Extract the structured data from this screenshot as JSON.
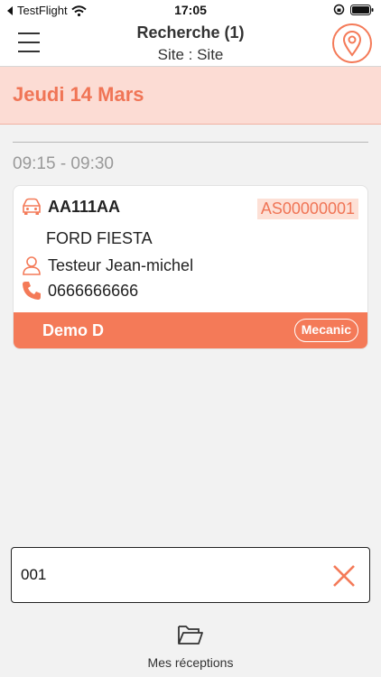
{
  "status_bar": {
    "back_app": "TestFlight",
    "time": "17:05",
    "icons": [
      "wifi-icon",
      "orientation-lock-icon",
      "battery-icon"
    ]
  },
  "nav": {
    "title": "Recherche (1)",
    "subtitle": "Site : Site",
    "icons": [
      "hamburger-menu-icon",
      "map-pin-icon"
    ]
  },
  "date_header": "Jeudi 14 Mars",
  "slot": {
    "time_range": "09:15 - 09:30",
    "card": {
      "plate": "AA111AA",
      "reference": "AS00000001",
      "model": "FORD FIESTA",
      "customer": "Testeur Jean-michel",
      "phone": "0666666666",
      "footer_name": "Demo D",
      "footer_tag": "Mecanic",
      "icons": [
        "car-icon",
        "person-icon",
        "phone-icon"
      ]
    }
  },
  "search": {
    "value": "001",
    "icons": [
      "clear-x-icon"
    ]
  },
  "tab_bar": {
    "label": "Mes réceptions",
    "icon": "folder-open-icon"
  },
  "colors": {
    "accent": "#f47a58",
    "header_background": "#fcdcd4",
    "badge_background": "#fde0d6"
  }
}
